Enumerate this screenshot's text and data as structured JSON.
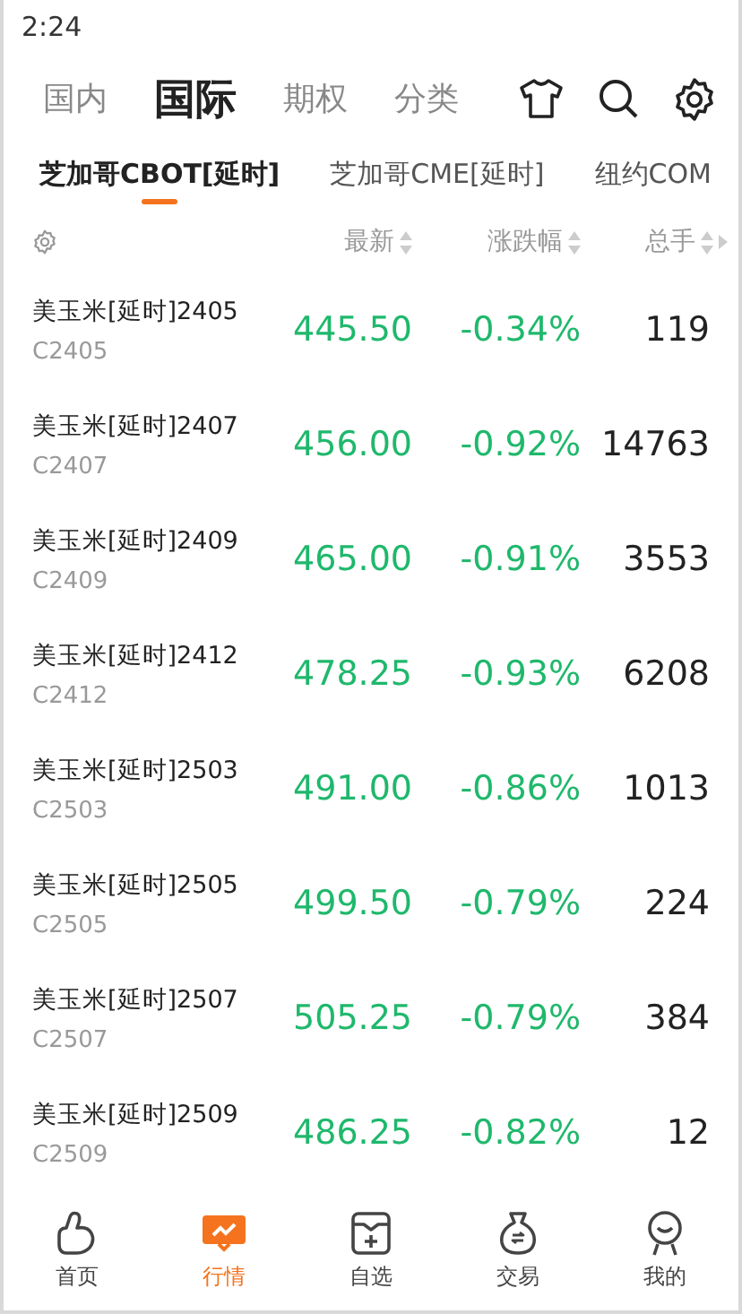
{
  "status_bar": {
    "time": "2:24"
  },
  "top_tabs": [
    {
      "label": "国内",
      "selected": false
    },
    {
      "label": "国际",
      "selected": true
    },
    {
      "label": "期权",
      "selected": false
    },
    {
      "label": "分类",
      "selected": false
    }
  ],
  "sub_tabs": [
    {
      "label": "芝加哥CBOT[延时]",
      "selected": true
    },
    {
      "label": "芝加哥CME[延时]",
      "selected": false
    },
    {
      "label": "纽约COM",
      "selected": false
    }
  ],
  "table": {
    "columns": [
      {
        "label": "最新"
      },
      {
        "label": "涨跌幅"
      },
      {
        "label": "总手"
      }
    ],
    "rows": [
      {
        "name": "美玉米[延时]2405",
        "code": "C2405",
        "price": "445.50",
        "change": "-0.34%",
        "volume": "119",
        "color": "#1fb86c"
      },
      {
        "name": "美玉米[延时]2407",
        "code": "C2407",
        "price": "456.00",
        "change": "-0.92%",
        "volume": "14763",
        "color": "#1fb86c"
      },
      {
        "name": "美玉米[延时]2409",
        "code": "C2409",
        "price": "465.00",
        "change": "-0.91%",
        "volume": "3553",
        "color": "#1fb86c"
      },
      {
        "name": "美玉米[延时]2412",
        "code": "C2412",
        "price": "478.25",
        "change": "-0.93%",
        "volume": "6208",
        "color": "#1fb86c"
      },
      {
        "name": "美玉米[延时]2503",
        "code": "C2503",
        "price": "491.00",
        "change": "-0.86%",
        "volume": "1013",
        "color": "#1fb86c"
      },
      {
        "name": "美玉米[延时]2505",
        "code": "C2505",
        "price": "499.50",
        "change": "-0.79%",
        "volume": "224",
        "color": "#1fb86c"
      },
      {
        "name": "美玉米[延时]2507",
        "code": "C2507",
        "price": "505.25",
        "change": "-0.79%",
        "volume": "384",
        "color": "#1fb86c"
      },
      {
        "name": "美玉米[延时]2509",
        "code": "C2509",
        "price": "486.25",
        "change": "-0.82%",
        "volume": "12",
        "color": "#1fb86c"
      }
    ]
  },
  "bottom_nav": [
    {
      "label": "首页",
      "selected": false
    },
    {
      "label": "行情",
      "selected": true
    },
    {
      "label": "自选",
      "selected": false
    },
    {
      "label": "交易",
      "selected": false
    },
    {
      "label": "我的",
      "selected": false
    }
  ]
}
